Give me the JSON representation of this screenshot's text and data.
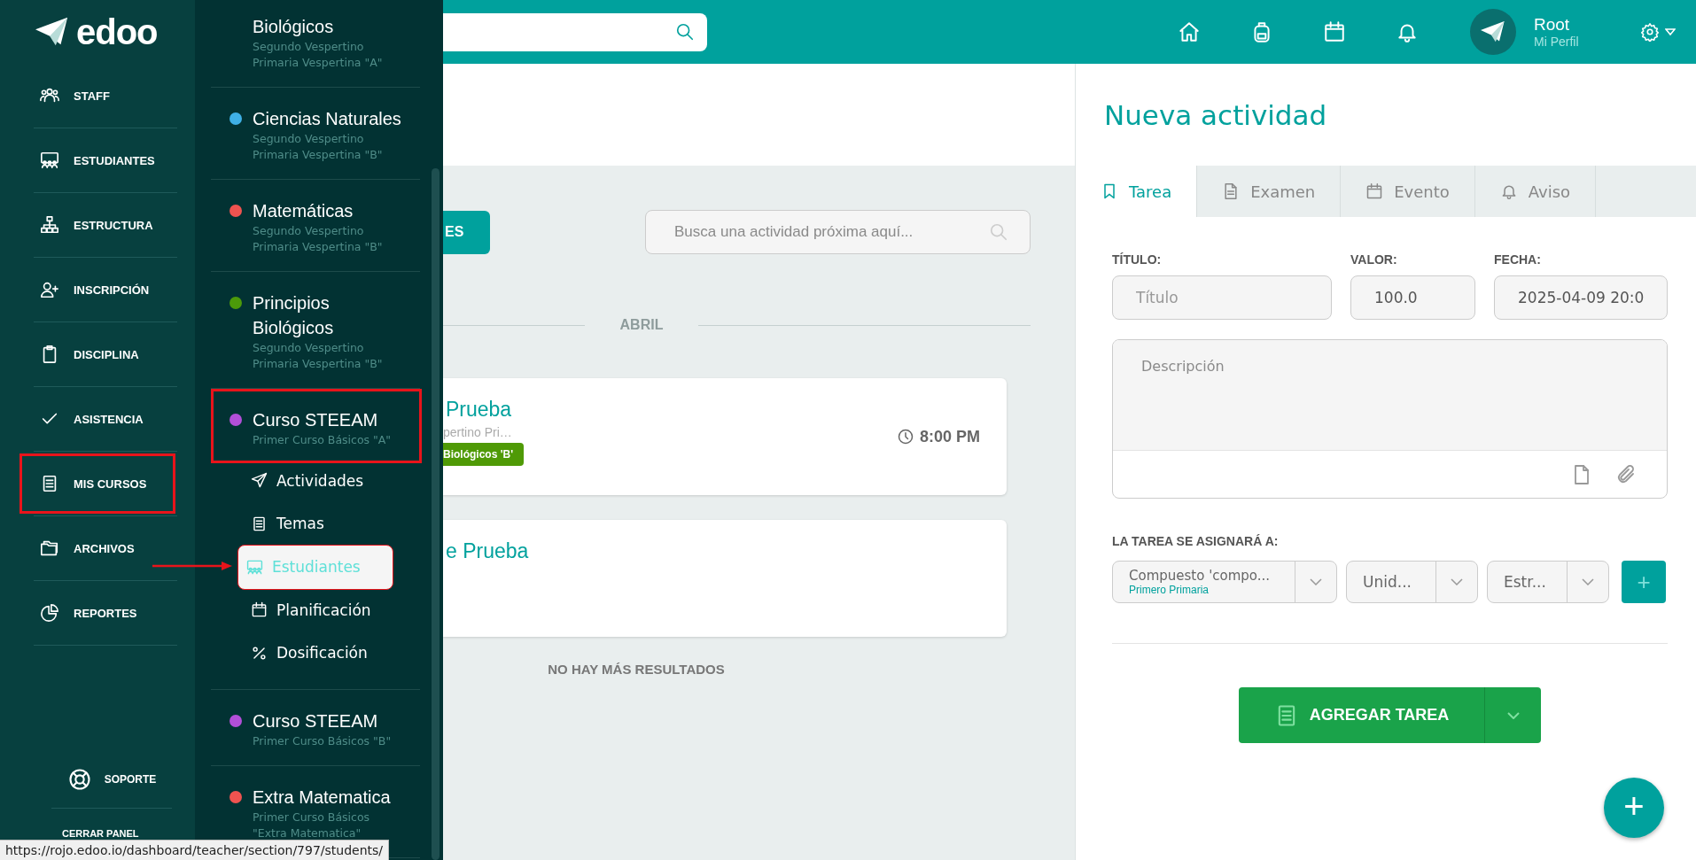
{
  "logo": {
    "text": "edoo"
  },
  "nav": {
    "items": [
      {
        "label": "STAFF",
        "kind": "staff",
        "highlighted": false
      },
      {
        "label": "ESTUDIANTES",
        "kind": "students",
        "highlighted": false
      },
      {
        "label": "ESTRUCTURA",
        "kind": "structure",
        "highlighted": false
      },
      {
        "label": "INSCRIPCIÓN",
        "kind": "enroll",
        "highlighted": false
      },
      {
        "label": "DISCIPLINA",
        "kind": "clipboard",
        "highlighted": false
      },
      {
        "label": "ASISTENCIA",
        "kind": "check",
        "highlighted": false
      },
      {
        "label": "MIS CURSOS",
        "kind": "book",
        "highlighted": true
      },
      {
        "label": "ARCHIVOS",
        "kind": "folder",
        "highlighted": false
      },
      {
        "label": "REPORTES",
        "kind": "pie",
        "highlighted": false
      }
    ],
    "support": "SOPORTE",
    "close": "CERRAR PANEL"
  },
  "courses": [
    {
      "name": "Biológicos",
      "lines": [
        "Segundo Vespertino",
        "Primaria Vespertina \"A\""
      ],
      "highlighted": false
    },
    {
      "name": "Ciencias Naturales",
      "lines": [
        "Segundo Vespertino",
        "Primaria Vespertina \"B\""
      ],
      "color": "#3fb0e6",
      "highlighted": false
    },
    {
      "name": "Matemáticas",
      "lines": [
        "Segundo Vespertino",
        "Primaria Vespertina \"B\""
      ],
      "color": "#ef5350",
      "highlighted": false
    },
    {
      "name": "Principios Biológicos",
      "lines": [
        "Segundo Vespertino",
        "Primaria Vespertina \"B\""
      ],
      "color": "#4c9a0a",
      "highlighted": false
    },
    {
      "name": "Curso STEEAM",
      "lines": [
        "Primer Curso Básicos \"A\""
      ],
      "color": "#b24fd8",
      "highlighted": true,
      "expanded": true,
      "children": [
        {
          "label": "Actividades",
          "kind": "send",
          "selected": false,
          "highlighted": false
        },
        {
          "label": "Temas",
          "kind": "book",
          "selected": false,
          "highlighted": false
        },
        {
          "label": "Estudiantes",
          "kind": "students",
          "selected": true,
          "highlighted": true
        },
        {
          "label": "Planificación",
          "kind": "calendar",
          "selected": false,
          "highlighted": false
        },
        {
          "label": "Dosificación",
          "kind": "percent",
          "selected": false,
          "highlighted": false
        }
      ]
    },
    {
      "name": "Curso STEEAM",
      "lines": [
        "Primer Curso Básicos \"B\""
      ],
      "color": "#b24fd8",
      "highlighted": false
    },
    {
      "name": "Extra Matematica",
      "lines": [
        "Primer Curso Básicos",
        "\"Extra Matematica\""
      ],
      "color": "#ef5350",
      "highlighted": false
    }
  ],
  "user": {
    "name": "Root",
    "link": "Mi Perfil"
  },
  "activities": {
    "filter_button": "ES",
    "search": {
      "placeholder": "Busca una actividad próxima aquí..."
    },
    "month": "ABRIL",
    "cards": [
      {
        "title": "Prueba",
        "subtitle": "pertino Pri…",
        "tag": "Biológicos 'B'",
        "time": "8:00 PM"
      },
      {
        "title": "e Prueba"
      }
    ],
    "end_note": "NO HAY MÁS RESULTADOS"
  },
  "form": {
    "title": "Nueva actividad",
    "tabs": [
      {
        "label": "Tarea",
        "kind": "bookmark",
        "selected": true
      },
      {
        "label": "Examen",
        "kind": "file",
        "selected": false
      },
      {
        "label": "Evento",
        "kind": "calendar",
        "selected": false
      },
      {
        "label": "Aviso",
        "kind": "bell",
        "selected": false
      }
    ],
    "fields": [
      {
        "label": "TÍTULO:",
        "placeholder": "Título"
      },
      {
        "label": "VALOR:",
        "value": "100.0"
      },
      {
        "label": "FECHA:",
        "value": "2025-04-09 20:0"
      }
    ],
    "description": {
      "placeholder": "Descripción"
    },
    "assign_label": "LA TAREA SE ASIGNARÁ A:",
    "selects": [
      {
        "value": "Compuesto 'compo...",
        "sub": "Primero Primaria"
      },
      {
        "value": "Unid..."
      },
      {
        "value": "Estr..."
      }
    ],
    "add_button": "+",
    "submit": "AGREGAR TAREA",
    "fab": "+"
  },
  "status_bar": {
    "url": "https://rojo.edoo.io/dashboard/teacher/section/797/students/"
  }
}
